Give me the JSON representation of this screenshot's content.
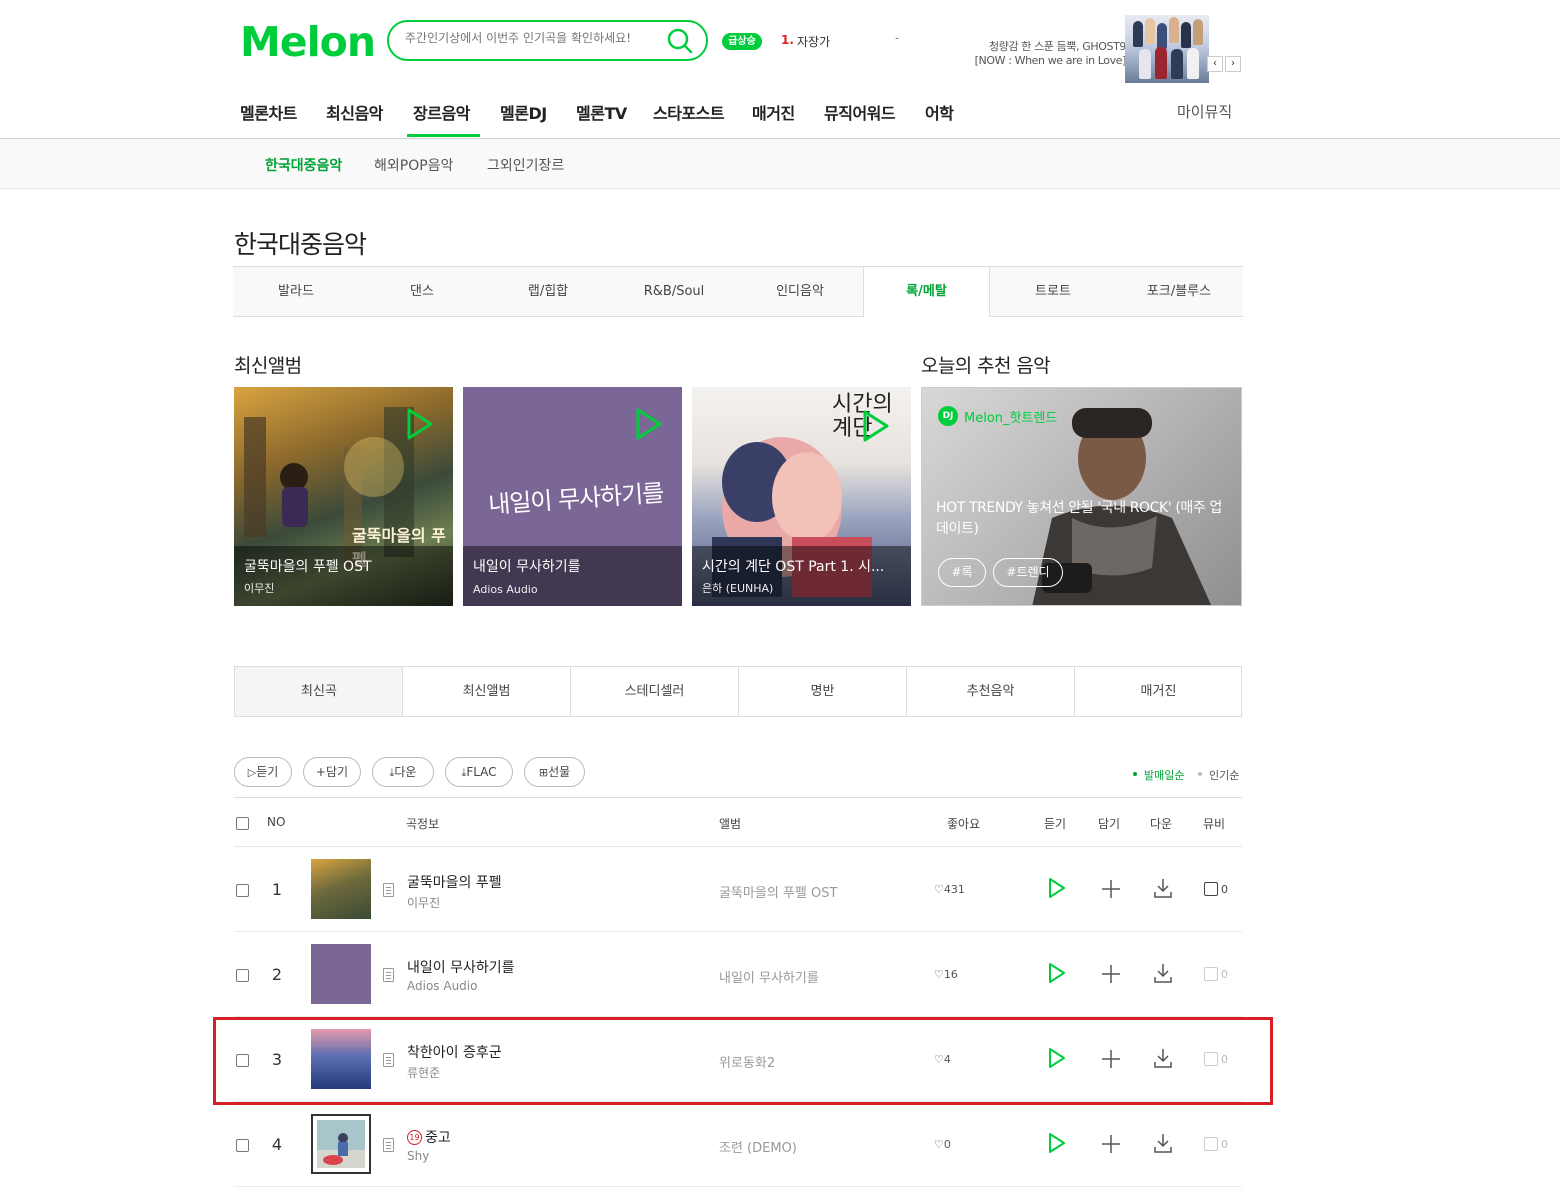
{
  "header": {
    "logo": "Melon",
    "search_placeholder": "주간인기상에서 이번주 인기곡을 확인하세요!",
    "rising_badge": "급상승",
    "rising_rank": "1.",
    "rising_title": "자장가",
    "rising_dash": "-",
    "now_line1": "청량감 한 스푼 듬뿍, GHOST9",
    "now_line2": "[NOW : When we are in Love]",
    "now_prev": "‹",
    "now_next": "›"
  },
  "gnb": {
    "items": [
      "멜론차트",
      "최신음악",
      "장르음악",
      "멜론DJ",
      "멜론TV",
      "스타포스트",
      "매거진",
      "뮤직어워드",
      "어학"
    ],
    "my_music": "마이뮤직",
    "active": "장르음악"
  },
  "subnav": {
    "items": [
      "한국대중음악",
      "해외POP음악",
      "그외인기장르"
    ],
    "active": "한국대중음악"
  },
  "page_title": "한국대중음악",
  "genre_tabs": [
    "발라드",
    "댄스",
    "랩/힙합",
    "R&B/Soul",
    "인디음악",
    "록/메탈",
    "트로트",
    "포크/블루스"
  ],
  "genre_active": "록/메탈",
  "latest_albums": {
    "heading": "최신앨범",
    "albums": [
      {
        "title": "굴뚝마을의 푸펠 OST",
        "artist": "이무진"
      },
      {
        "title": "내일이 무사하기를",
        "artist": "Adios Audio"
      },
      {
        "title": "시간의 계단 OST Part 1. 시...",
        "artist": "은하 (EUNHA)"
      }
    ],
    "album2_cover_text": "내일이 무사하기를",
    "album1_cover_text": "굴뚝마을의 푸펠",
    "album3_cover_text": "시간의 계단"
  },
  "recommend": {
    "heading": "오늘의 추천 음악",
    "dj_badge": "DJ",
    "dj_name": "Melon_핫트렌드",
    "title": "HOT TRENDY 놓쳐선 안될 '국내 ROCK' (매주 업데이트)",
    "tags": [
      "#록",
      "#트렌디"
    ]
  },
  "content_tabs": [
    "최신곡",
    "최신앨범",
    "스테디셀러",
    "명반",
    "추천음악",
    "매거진"
  ],
  "content_tab_active": "최신곡",
  "actions": {
    "listen": "듣기",
    "add": "담기",
    "download": "다운",
    "flac": "FLAC",
    "gift": "선물"
  },
  "sort": {
    "by_release": "발매일순",
    "by_popularity": "인기순",
    "active": "발매일순",
    "accent": "#00a335"
  },
  "table": {
    "headers": {
      "no": "NO",
      "song": "곡정보",
      "album": "앨범",
      "like": "좋아요",
      "listen": "듣기",
      "add": "담기",
      "download": "다운",
      "mv": "뮤비"
    },
    "rows": [
      {
        "no": "1",
        "title": "굴뚝마을의 푸펠",
        "artist": "이무진",
        "album": "굴뚝마을의 푸펠 OST",
        "likes": "431",
        "mv": "0",
        "mv_available": true,
        "adult": false
      },
      {
        "no": "2",
        "title": "내일이 무사하기를",
        "artist": "Adios Audio",
        "album": "내일이 무사하기를",
        "likes": "16",
        "mv": "0",
        "mv_available": false,
        "adult": false
      },
      {
        "no": "3",
        "title": "착한아이 증후군",
        "artist": "류현준",
        "album": "위로동화2",
        "likes": "4",
        "mv": "0",
        "mv_available": false,
        "adult": false
      },
      {
        "no": "4",
        "title": "중고",
        "artist": "Shy",
        "album": "조련 (DEMO)",
        "likes": "0",
        "mv": "0",
        "mv_available": false,
        "adult": true,
        "adult_mark": "19"
      }
    ]
  },
  "colors": {
    "brand": "#00cd3c",
    "highlight": "#d81f26"
  }
}
